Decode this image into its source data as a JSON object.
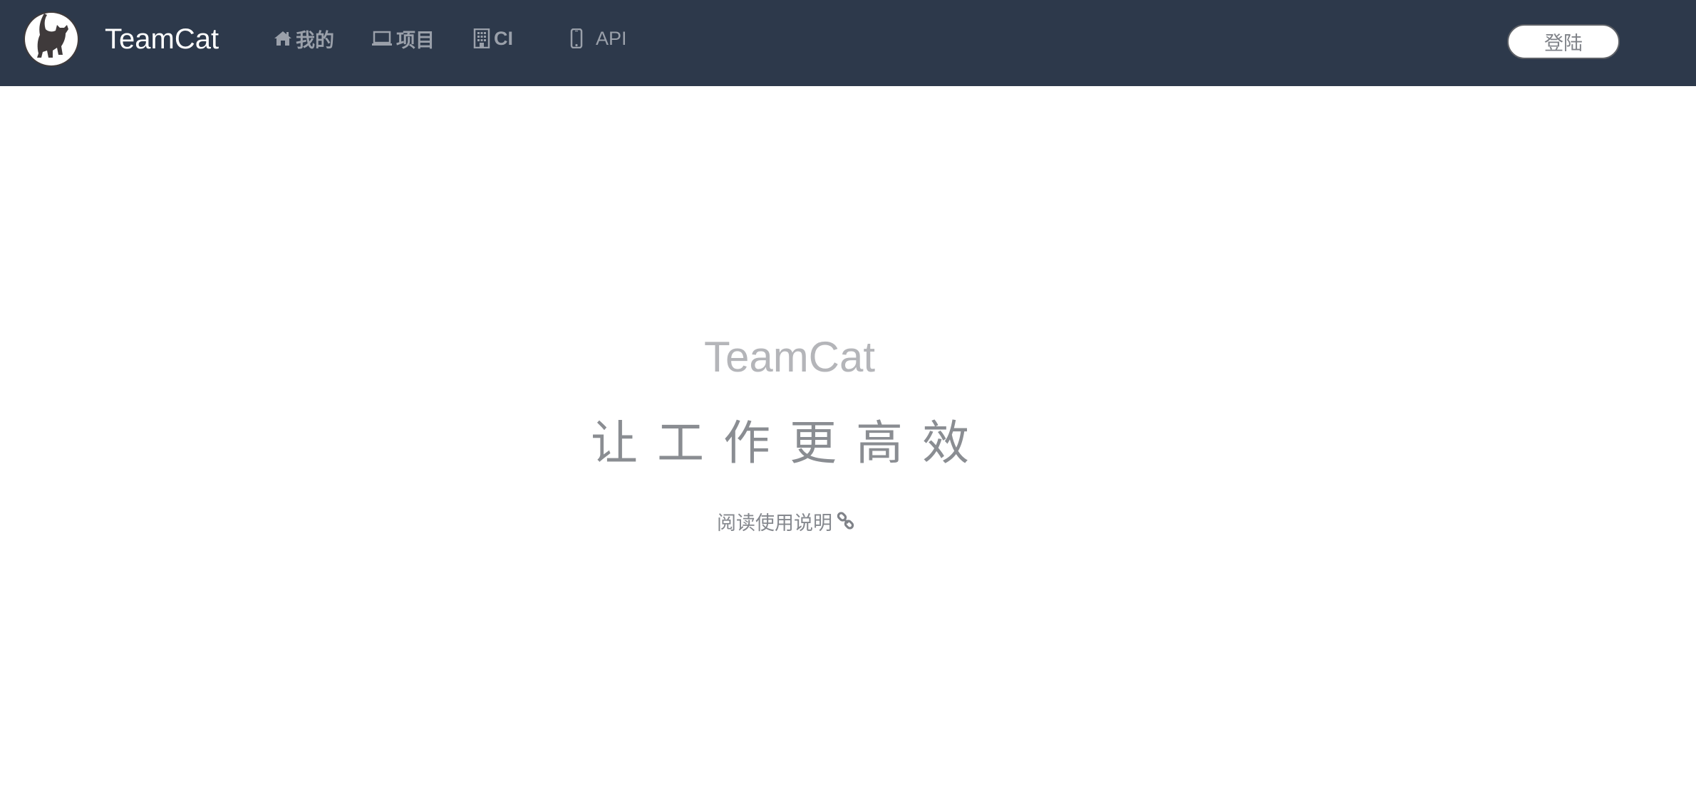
{
  "header": {
    "brand": "TeamCat",
    "logo_icon": "cat-logo-icon",
    "nav": [
      {
        "label": "我的",
        "icon": "home-icon"
      },
      {
        "label": "项目",
        "icon": "laptop-icon"
      },
      {
        "label": "CI",
        "icon": "building-icon"
      },
      {
        "label": "API",
        "icon": "mobile-icon"
      }
    ],
    "login_label": "登陆"
  },
  "hero": {
    "title": "TeamCat",
    "slogan": "让工作更高效",
    "guide_link": "阅读使用说明",
    "guide_icon": "link-icon"
  },
  "colors": {
    "header_bg": "#2d394b",
    "nav_text": "#9aa0aa",
    "hero_title": "#b4b5b9",
    "hero_slogan": "#8a8d92"
  }
}
